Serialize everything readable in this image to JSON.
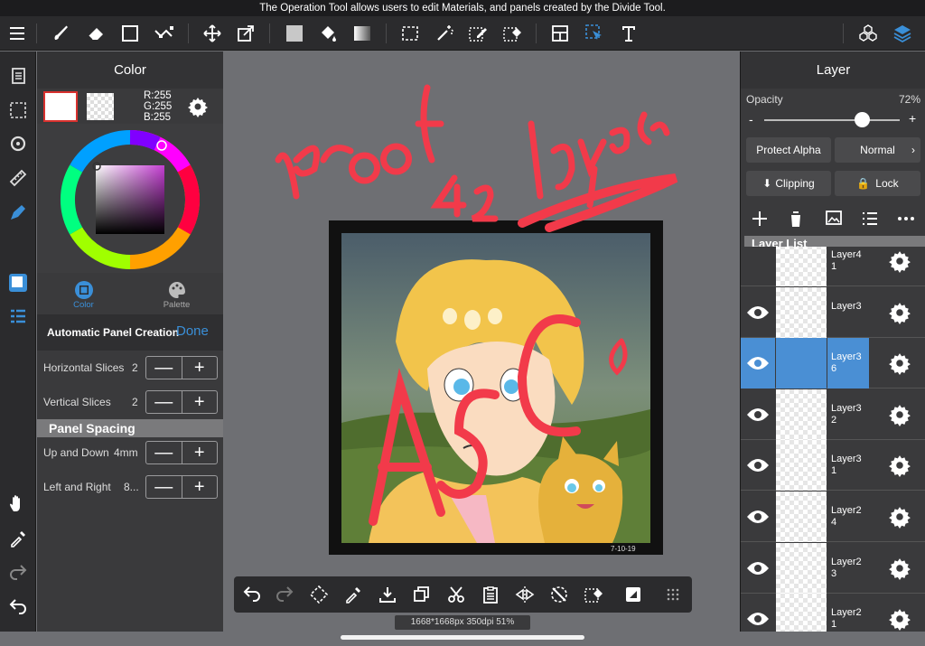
{
  "tooltip": "The Operation Tool allows users to edit Materials, and panels created by the Divide Tool.",
  "toolbar": {
    "items": [
      "menu",
      "brush",
      "eraser",
      "rectangle",
      "vector-line",
      "move",
      "transform",
      "fill-color",
      "bucket",
      "gradient",
      "select-rect",
      "magic-wand",
      "select-pen",
      "select-eraser",
      "frame-divide",
      "operation",
      "text",
      "materials",
      "layers"
    ]
  },
  "color_panel": {
    "title": "Color",
    "r": "R:255",
    "g": "G:255",
    "b": "B:255",
    "tab_color": "Color",
    "tab_palette": "Palette",
    "auto_panel_label": "Automatic Panel Creation",
    "done": "Done",
    "horizontal_slices_label": "Horizontal Slices",
    "horizontal_slices_value": "2",
    "vertical_slices_label": "Vertical Slices",
    "vertical_slices_value": "2",
    "panel_spacing": "Panel Spacing",
    "up_down_label": "Up and Down",
    "up_down_value": "4mm",
    "left_right_label": "Left and Right",
    "left_right_value": "8...",
    "minus": "—",
    "plus": "+"
  },
  "canvas": {
    "handwriting_proof": "proof",
    "handwriting_layers": "42 layers",
    "handwriting_asc": "ASC",
    "signature_date": "7-10-19"
  },
  "bottom_bar": {
    "size_info": "1668*1668px 350dpi 51%"
  },
  "layer_panel": {
    "title": "Layer",
    "opacity_label": "Opacity",
    "opacity_value": "72%",
    "opacity_fraction": 0.72,
    "minus": "-",
    "plus": "+",
    "protect_alpha": "Protect Alpha",
    "blend_mode": "Normal",
    "clipping": "Clipping",
    "lock": "Lock",
    "layer_list_label": "Layer List",
    "layers": [
      {
        "name": "Layer4\n1",
        "visible": true,
        "selected": false
      },
      {
        "name": "Layer3",
        "visible": true,
        "selected": false
      },
      {
        "name": "Layer3\n6",
        "visible": true,
        "selected": true
      },
      {
        "name": "Layer3\n2",
        "visible": true,
        "selected": false
      },
      {
        "name": "Layer3\n1",
        "visible": true,
        "selected": false
      },
      {
        "name": "Layer2\n4",
        "visible": true,
        "selected": false
      },
      {
        "name": "Layer2\n3",
        "visible": true,
        "selected": false
      },
      {
        "name": "Layer2\n1",
        "visible": true,
        "selected": false
      }
    ]
  },
  "colors": {
    "accent": "#3a8fd8",
    "selected_layer": "#4a8fd4",
    "annotation_red": "#f23a4a"
  }
}
